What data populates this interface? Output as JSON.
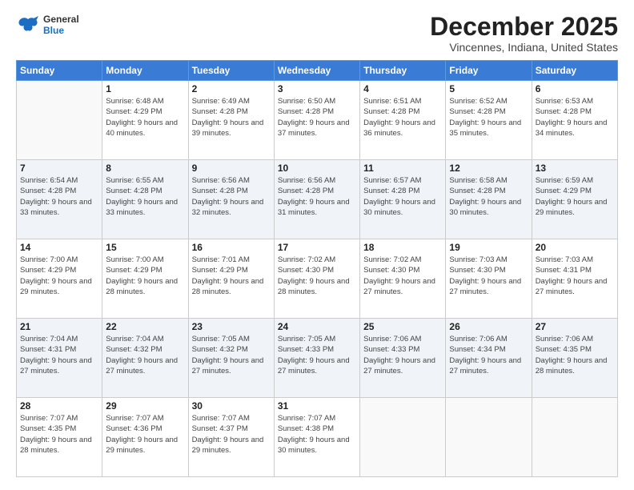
{
  "header": {
    "logo": {
      "general": "General",
      "blue": "Blue"
    },
    "title": "December 2025",
    "location": "Vincennes, Indiana, United States"
  },
  "weekdays": [
    "Sunday",
    "Monday",
    "Tuesday",
    "Wednesday",
    "Thursday",
    "Friday",
    "Saturday"
  ],
  "weeks": [
    [
      {
        "day": "",
        "empty": true
      },
      {
        "day": "1",
        "sunrise": "Sunrise: 6:48 AM",
        "sunset": "Sunset: 4:29 PM",
        "daylight": "Daylight: 9 hours and 40 minutes."
      },
      {
        "day": "2",
        "sunrise": "Sunrise: 6:49 AM",
        "sunset": "Sunset: 4:28 PM",
        "daylight": "Daylight: 9 hours and 39 minutes."
      },
      {
        "day": "3",
        "sunrise": "Sunrise: 6:50 AM",
        "sunset": "Sunset: 4:28 PM",
        "daylight": "Daylight: 9 hours and 37 minutes."
      },
      {
        "day": "4",
        "sunrise": "Sunrise: 6:51 AM",
        "sunset": "Sunset: 4:28 PM",
        "daylight": "Daylight: 9 hours and 36 minutes."
      },
      {
        "day": "5",
        "sunrise": "Sunrise: 6:52 AM",
        "sunset": "Sunset: 4:28 PM",
        "daylight": "Daylight: 9 hours and 35 minutes."
      },
      {
        "day": "6",
        "sunrise": "Sunrise: 6:53 AM",
        "sunset": "Sunset: 4:28 PM",
        "daylight": "Daylight: 9 hours and 34 minutes."
      }
    ],
    [
      {
        "day": "7",
        "sunrise": "Sunrise: 6:54 AM",
        "sunset": "Sunset: 4:28 PM",
        "daylight": "Daylight: 9 hours and 33 minutes."
      },
      {
        "day": "8",
        "sunrise": "Sunrise: 6:55 AM",
        "sunset": "Sunset: 4:28 PM",
        "daylight": "Daylight: 9 hours and 33 minutes."
      },
      {
        "day": "9",
        "sunrise": "Sunrise: 6:56 AM",
        "sunset": "Sunset: 4:28 PM",
        "daylight": "Daylight: 9 hours and 32 minutes."
      },
      {
        "day": "10",
        "sunrise": "Sunrise: 6:56 AM",
        "sunset": "Sunset: 4:28 PM",
        "daylight": "Daylight: 9 hours and 31 minutes."
      },
      {
        "day": "11",
        "sunrise": "Sunrise: 6:57 AM",
        "sunset": "Sunset: 4:28 PM",
        "daylight": "Daylight: 9 hours and 30 minutes."
      },
      {
        "day": "12",
        "sunrise": "Sunrise: 6:58 AM",
        "sunset": "Sunset: 4:28 PM",
        "daylight": "Daylight: 9 hours and 30 minutes."
      },
      {
        "day": "13",
        "sunrise": "Sunrise: 6:59 AM",
        "sunset": "Sunset: 4:29 PM",
        "daylight": "Daylight: 9 hours and 29 minutes."
      }
    ],
    [
      {
        "day": "14",
        "sunrise": "Sunrise: 7:00 AM",
        "sunset": "Sunset: 4:29 PM",
        "daylight": "Daylight: 9 hours and 29 minutes."
      },
      {
        "day": "15",
        "sunrise": "Sunrise: 7:00 AM",
        "sunset": "Sunset: 4:29 PM",
        "daylight": "Daylight: 9 hours and 28 minutes."
      },
      {
        "day": "16",
        "sunrise": "Sunrise: 7:01 AM",
        "sunset": "Sunset: 4:29 PM",
        "daylight": "Daylight: 9 hours and 28 minutes."
      },
      {
        "day": "17",
        "sunrise": "Sunrise: 7:02 AM",
        "sunset": "Sunset: 4:30 PM",
        "daylight": "Daylight: 9 hours and 28 minutes."
      },
      {
        "day": "18",
        "sunrise": "Sunrise: 7:02 AM",
        "sunset": "Sunset: 4:30 PM",
        "daylight": "Daylight: 9 hours and 27 minutes."
      },
      {
        "day": "19",
        "sunrise": "Sunrise: 7:03 AM",
        "sunset": "Sunset: 4:30 PM",
        "daylight": "Daylight: 9 hours and 27 minutes."
      },
      {
        "day": "20",
        "sunrise": "Sunrise: 7:03 AM",
        "sunset": "Sunset: 4:31 PM",
        "daylight": "Daylight: 9 hours and 27 minutes."
      }
    ],
    [
      {
        "day": "21",
        "sunrise": "Sunrise: 7:04 AM",
        "sunset": "Sunset: 4:31 PM",
        "daylight": "Daylight: 9 hours and 27 minutes."
      },
      {
        "day": "22",
        "sunrise": "Sunrise: 7:04 AM",
        "sunset": "Sunset: 4:32 PM",
        "daylight": "Daylight: 9 hours and 27 minutes."
      },
      {
        "day": "23",
        "sunrise": "Sunrise: 7:05 AM",
        "sunset": "Sunset: 4:32 PM",
        "daylight": "Daylight: 9 hours and 27 minutes."
      },
      {
        "day": "24",
        "sunrise": "Sunrise: 7:05 AM",
        "sunset": "Sunset: 4:33 PM",
        "daylight": "Daylight: 9 hours and 27 minutes."
      },
      {
        "day": "25",
        "sunrise": "Sunrise: 7:06 AM",
        "sunset": "Sunset: 4:33 PM",
        "daylight": "Daylight: 9 hours and 27 minutes."
      },
      {
        "day": "26",
        "sunrise": "Sunrise: 7:06 AM",
        "sunset": "Sunset: 4:34 PM",
        "daylight": "Daylight: 9 hours and 27 minutes."
      },
      {
        "day": "27",
        "sunrise": "Sunrise: 7:06 AM",
        "sunset": "Sunset: 4:35 PM",
        "daylight": "Daylight: 9 hours and 28 minutes."
      }
    ],
    [
      {
        "day": "28",
        "sunrise": "Sunrise: 7:07 AM",
        "sunset": "Sunset: 4:35 PM",
        "daylight": "Daylight: 9 hours and 28 minutes."
      },
      {
        "day": "29",
        "sunrise": "Sunrise: 7:07 AM",
        "sunset": "Sunset: 4:36 PM",
        "daylight": "Daylight: 9 hours and 29 minutes."
      },
      {
        "day": "30",
        "sunrise": "Sunrise: 7:07 AM",
        "sunset": "Sunset: 4:37 PM",
        "daylight": "Daylight: 9 hours and 29 minutes."
      },
      {
        "day": "31",
        "sunrise": "Sunrise: 7:07 AM",
        "sunset": "Sunset: 4:38 PM",
        "daylight": "Daylight: 9 hours and 30 minutes."
      },
      {
        "day": "",
        "empty": true
      },
      {
        "day": "",
        "empty": true
      },
      {
        "day": "",
        "empty": true
      }
    ]
  ]
}
